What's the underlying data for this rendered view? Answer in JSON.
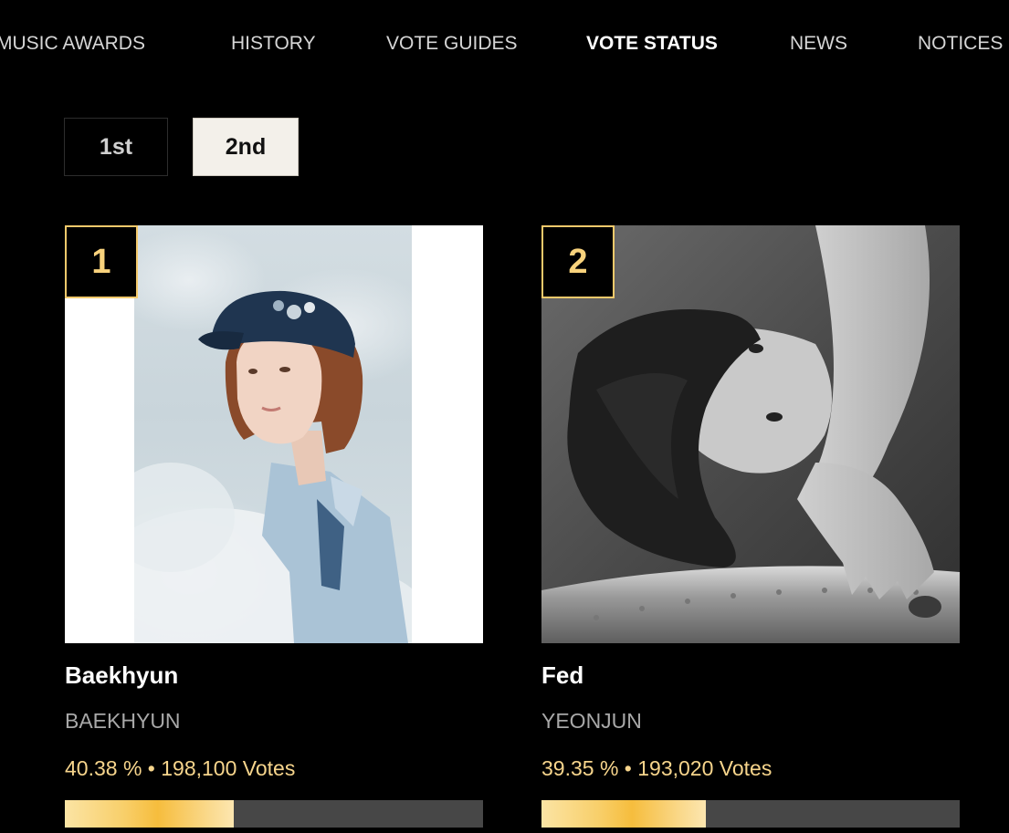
{
  "nav": {
    "items": [
      {
        "label": "MUSIC AWARDS",
        "active": false
      },
      {
        "label": "HISTORY",
        "active": false
      },
      {
        "label": "VOTE GUIDES",
        "active": false
      },
      {
        "label": "VOTE STATUS",
        "active": true
      },
      {
        "label": "NEWS",
        "active": false
      },
      {
        "label": "NOTICES",
        "active": false
      }
    ]
  },
  "rounds": {
    "tabs": [
      {
        "label": "1st",
        "active": false
      },
      {
        "label": "2nd",
        "active": true
      }
    ]
  },
  "entries": [
    {
      "rank": "1",
      "title": "Baekhyun",
      "artist": "BAEKHYUN",
      "percent_text": "40.38 %",
      "separator": "•",
      "votes_text": "198,100 Votes",
      "progress": 0.4038
    },
    {
      "rank": "2",
      "title": "Fed",
      "artist": "YEONJUN",
      "percent_text": "39.35 %",
      "separator": "•",
      "votes_text": "193,020 Votes",
      "progress": 0.3935
    }
  ],
  "colors": {
    "background": "#000000",
    "accent_gold": "#f4c96b",
    "vote_text": "#f7d58c",
    "track": "#474747",
    "active_tab_bg": "#f3f0ea"
  }
}
